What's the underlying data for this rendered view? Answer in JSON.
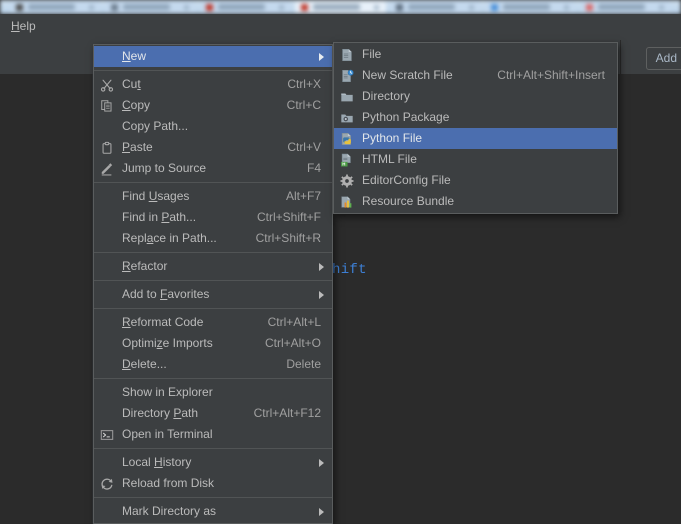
{
  "browser": {
    "tabs": [
      {
        "favicon_color": "#4a4a4a",
        "active": false
      },
      {
        "favicon_color": "#6b7b8c",
        "active": false
      },
      {
        "favicon_color": "#c0392b",
        "active": false
      },
      {
        "favicon_color": "#c0392b",
        "active": true
      },
      {
        "favicon_color": "#5b6b7c",
        "active": false
      },
      {
        "favicon_color": "#4a90d9",
        "active": false
      },
      {
        "favicon_color": "#d96a6a",
        "active": false
      }
    ]
  },
  "menubar": {
    "items": [
      {
        "label": "Help",
        "mnemonic": "H"
      }
    ]
  },
  "toolbar": {
    "add_config_label": "Add C",
    "add_config_icon": "dropdown-icon"
  },
  "editor": {
    "code_fragment": "hift",
    "code_color": "#3d7fd4",
    "background": "#2b2b2b"
  },
  "context_menu": {
    "name": "project-view-context-menu",
    "groups": [
      {
        "items": [
          {
            "label": "New",
            "mnemonic": "N",
            "accel": "",
            "icon": "",
            "submenu": true,
            "selected": true
          }
        ]
      },
      {
        "items": [
          {
            "label": "Cut",
            "mnemonic": "t",
            "accel": "Ctrl+X",
            "icon": "scissors-icon",
            "submenu": false,
            "selected": false
          },
          {
            "label": "Copy",
            "mnemonic": "C",
            "accel": "Ctrl+C",
            "icon": "copy-icon",
            "submenu": false,
            "selected": false
          },
          {
            "label": "Copy Path...",
            "mnemonic": "",
            "accel": "",
            "icon": "",
            "submenu": false,
            "selected": false
          },
          {
            "label": "Paste",
            "mnemonic": "P",
            "accel": "Ctrl+V",
            "icon": "clipboard-icon",
            "submenu": false,
            "selected": false
          },
          {
            "label": "Jump to Source",
            "mnemonic": "",
            "accel": "F4",
            "icon": "pencil-icon",
            "submenu": false,
            "selected": false
          }
        ]
      },
      {
        "items": [
          {
            "label": "Find Usages",
            "mnemonic": "U",
            "accel": "Alt+F7",
            "icon": "",
            "submenu": false,
            "selected": false
          },
          {
            "label": "Find in Path...",
            "mnemonic": "P",
            "accel": "Ctrl+Shift+F",
            "icon": "",
            "submenu": false,
            "selected": false
          },
          {
            "label": "Replace in Path...",
            "mnemonic": "a",
            "accel": "Ctrl+Shift+R",
            "icon": "",
            "submenu": false,
            "selected": false
          }
        ]
      },
      {
        "items": [
          {
            "label": "Refactor",
            "mnemonic": "R",
            "accel": "",
            "icon": "",
            "submenu": true,
            "selected": false
          }
        ]
      },
      {
        "items": [
          {
            "label": "Add to Favorites",
            "mnemonic": "F",
            "accel": "",
            "icon": "",
            "submenu": true,
            "selected": false
          }
        ]
      },
      {
        "items": [
          {
            "label": "Reformat Code",
            "mnemonic": "R",
            "accel": "Ctrl+Alt+L",
            "icon": "",
            "submenu": false,
            "selected": false
          },
          {
            "label": "Optimize Imports",
            "mnemonic": "z",
            "accel": "Ctrl+Alt+O",
            "icon": "",
            "submenu": false,
            "selected": false
          },
          {
            "label": "Delete...",
            "mnemonic": "D",
            "accel": "Delete",
            "icon": "",
            "submenu": false,
            "selected": false
          }
        ]
      },
      {
        "items": [
          {
            "label": "Show in Explorer",
            "mnemonic": "",
            "accel": "",
            "icon": "",
            "submenu": false,
            "selected": false
          },
          {
            "label": "Directory Path",
            "mnemonic": "P",
            "accel": "Ctrl+Alt+F12",
            "icon": "",
            "submenu": false,
            "selected": false
          },
          {
            "label": "Open in Terminal",
            "mnemonic": "",
            "accel": "",
            "icon": "terminal-icon",
            "submenu": false,
            "selected": false
          }
        ]
      },
      {
        "items": [
          {
            "label": "Local History",
            "mnemonic": "H",
            "accel": "",
            "icon": "",
            "submenu": true,
            "selected": false
          },
          {
            "label": "Reload from Disk",
            "mnemonic": "",
            "accel": "",
            "icon": "reload-icon",
            "submenu": false,
            "selected": false
          }
        ]
      },
      {
        "items": [
          {
            "label": "Mark Directory as",
            "mnemonic": "",
            "accel": "",
            "icon": "",
            "submenu": true,
            "selected": false
          }
        ]
      }
    ]
  },
  "new_submenu": {
    "name": "new-submenu",
    "items": [
      {
        "label": "File",
        "accel": "",
        "icon": "file-icon",
        "selected": false
      },
      {
        "label": "New Scratch File",
        "accel": "Ctrl+Alt+Shift+Insert",
        "icon": "scratch-file-icon",
        "selected": false
      },
      {
        "label": "Directory",
        "accel": "",
        "icon": "folder-icon",
        "selected": false
      },
      {
        "label": "Python Package",
        "accel": "",
        "icon": "python-package-icon",
        "selected": false
      },
      {
        "label": "Python File",
        "accel": "",
        "icon": "python-file-icon",
        "selected": true
      },
      {
        "label": "HTML File",
        "accel": "",
        "icon": "html-file-icon",
        "selected": false
      },
      {
        "label": "EditorConfig File",
        "accel": "",
        "icon": "gear-icon",
        "selected": false
      },
      {
        "label": "Resource Bundle",
        "accel": "",
        "icon": "resource-bundle-icon",
        "selected": false
      }
    ]
  },
  "colors": {
    "menu_background": "#3c3f41",
    "editor_background": "#2b2b2b",
    "selection": "#4b6eaf",
    "text": "#bbbbbb",
    "accelerator_text": "#a0a0a0"
  }
}
